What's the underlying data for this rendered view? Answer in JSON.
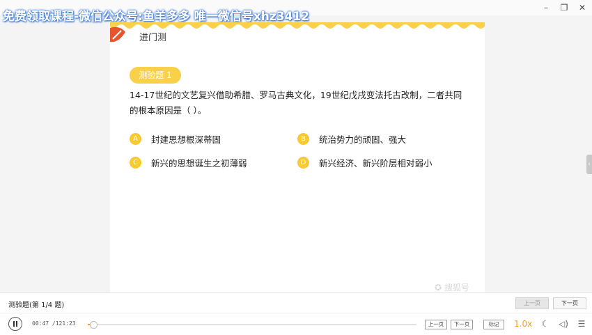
{
  "window": {
    "watermark": "免费领取课程-微信公众号:鱼羊多多 唯一微信号xhz3412",
    "minimize_icon": "minimize-icon",
    "maximize_icon": "maximize-icon",
    "close_icon": "close-icon"
  },
  "slide": {
    "heading": "进门测",
    "badge": "测验题 1",
    "question": "14-17世纪的文艺复兴借助希腊、罗马古典文化，19世纪戊戌变法托古改制，二者共同的根本原因是（   ）。",
    "options": [
      {
        "letter": "A",
        "text": "封建思想根深蒂固"
      },
      {
        "letter": "B",
        "text": "统治势力的顽固、强大"
      },
      {
        "letter": "C",
        "text": "新兴的思想诞生之初薄弱"
      },
      {
        "letter": "D",
        "text": "新兴经济、新兴阶层相对弱小"
      }
    ],
    "logo": "✪ 搜狐号"
  },
  "quiz_bar": {
    "label": "测验题(第 1/4 题)",
    "prev": "上一页",
    "next": "下一页"
  },
  "player": {
    "time": "00:47 /121:23",
    "progress": 0.0065,
    "prev": "上一页",
    "next": "下一页",
    "mark": "标记",
    "speed": "1.0x",
    "colors": {
      "accent": "#f59c2a",
      "badge": "#f9d04a"
    }
  }
}
